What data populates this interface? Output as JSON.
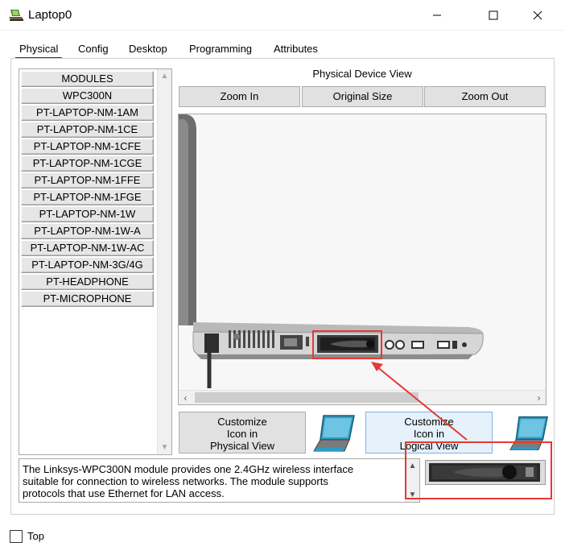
{
  "window": {
    "title": "Laptop0",
    "icon": "laptop-app-icon"
  },
  "tabs": [
    {
      "label": "Physical",
      "active": true
    },
    {
      "label": "Config",
      "active": false
    },
    {
      "label": "Desktop",
      "active": false
    },
    {
      "label": "Programming",
      "active": false
    },
    {
      "label": "Attributes",
      "active": false
    }
  ],
  "modules": {
    "items": [
      "MODULES",
      "WPC300N",
      "PT-LAPTOP-NM-1AM",
      "PT-LAPTOP-NM-1CE",
      "PT-LAPTOP-NM-1CFE",
      "PT-LAPTOP-NM-1CGE",
      "PT-LAPTOP-NM-1FFE",
      "PT-LAPTOP-NM-1FGE",
      "PT-LAPTOP-NM-1W",
      "PT-LAPTOP-NM-1W-A",
      "PT-LAPTOP-NM-1W-AC",
      "PT-LAPTOP-NM-3G/4G",
      "PT-HEADPHONE",
      "PT-MICROPHONE"
    ]
  },
  "device_view": {
    "title": "Physical Device View",
    "zoom_in": "Zoom In",
    "original_size": "Original Size",
    "zoom_out": "Zoom Out"
  },
  "customize": {
    "physical": [
      "Customize",
      "Icon in",
      "Physical View"
    ],
    "logical": [
      "Customize",
      "Icon in",
      "Logical View"
    ]
  },
  "description": {
    "lines": [
      "The Linksys-WPC300N module provides one 2.4GHz wireless interface",
      "suitable for connection to wireless networks. The module supports",
      "protocols that use Ethernet for LAN access."
    ]
  },
  "bottom": {
    "top_label": "Top",
    "top_checked": false
  },
  "colors": {
    "annotation": "#e53935",
    "active_tab_underline": "#1e3a6e",
    "logical_button_bg": "#e5f1fb",
    "laptop_icon": "#2e9bc4"
  }
}
